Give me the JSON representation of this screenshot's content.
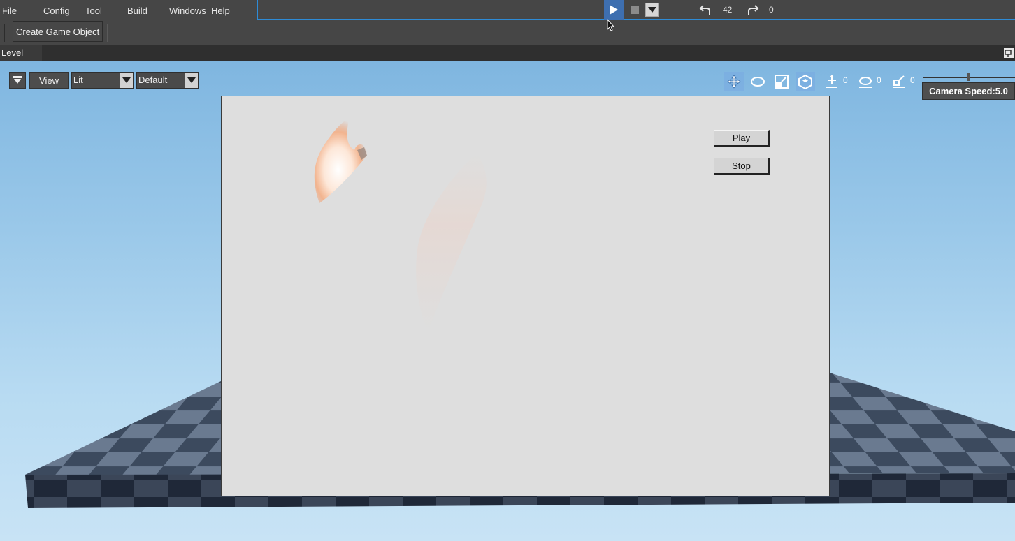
{
  "menubar": {
    "items": [
      "File",
      "Config",
      "Tool",
      "Build",
      "Windows",
      "Help"
    ]
  },
  "playbar": {
    "play_icon": "play-icon",
    "stop_icon": "stop-icon",
    "dropdown_icon": "chevron-down-icon",
    "undo_count": "42",
    "redo_count": "0",
    "accent": "#2e8bd6",
    "play_bg": "#3e6fb0"
  },
  "toolbar": {
    "create_label": "Create Game Object"
  },
  "tabs": {
    "level_label": "Level"
  },
  "viewport": {
    "view_label": "View",
    "shading_value": "Lit",
    "layout_value": "Default",
    "translate_count": "0",
    "rotate_count": "0",
    "scale_count": "0",
    "camera_speed_label": "Camera Speed:5.0",
    "camera_speed": 5.0,
    "sky_color": "#9ac8e9",
    "floor_dark": "#3c4a5e",
    "floor_light": "#6a7a90"
  },
  "game": {
    "play_label": "Play",
    "stop_label": "Stop",
    "panel_bg": "#dedede"
  }
}
